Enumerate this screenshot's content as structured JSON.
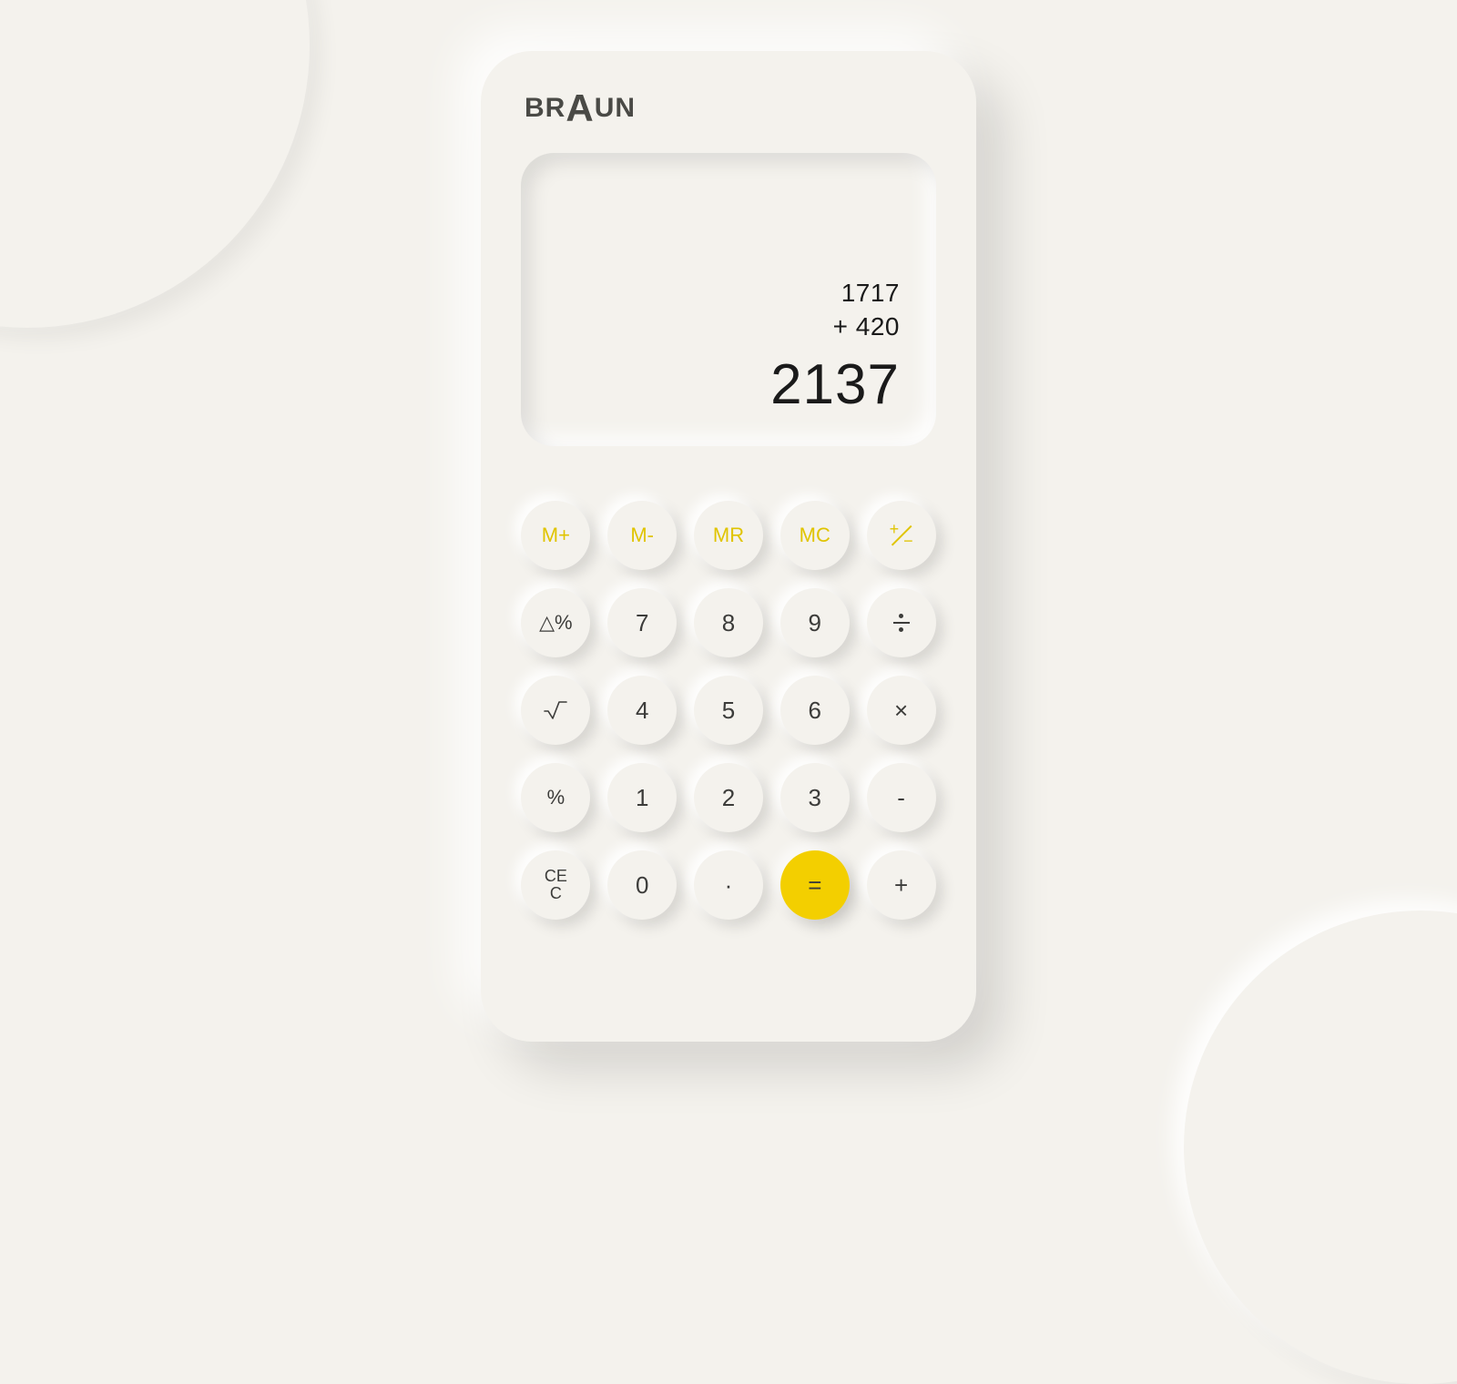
{
  "brand": {
    "left": "BR",
    "mid": "A",
    "right": "UN"
  },
  "display": {
    "line1": "1717",
    "line2": "+ 420",
    "result": "2137"
  },
  "keys": {
    "mplus": "M+",
    "mminus": "M-",
    "mr": "MR",
    "mc": "MC",
    "delta_pct": "△%",
    "d7": "7",
    "d8": "8",
    "d9": "9",
    "d4": "4",
    "d5": "5",
    "d6": "6",
    "d1": "1",
    "d2": "2",
    "d3": "3",
    "d0": "0",
    "pct": "%",
    "mul": "×",
    "sub": "-",
    "add": "+",
    "dot": "·",
    "eq": "=",
    "ce_top": "CE",
    "ce_bot": "C"
  },
  "colors": {
    "accent": "#f3cf00",
    "accent_text": "#e0c400",
    "bg": "#f4f2ed",
    "text": "#3c3c3a"
  }
}
